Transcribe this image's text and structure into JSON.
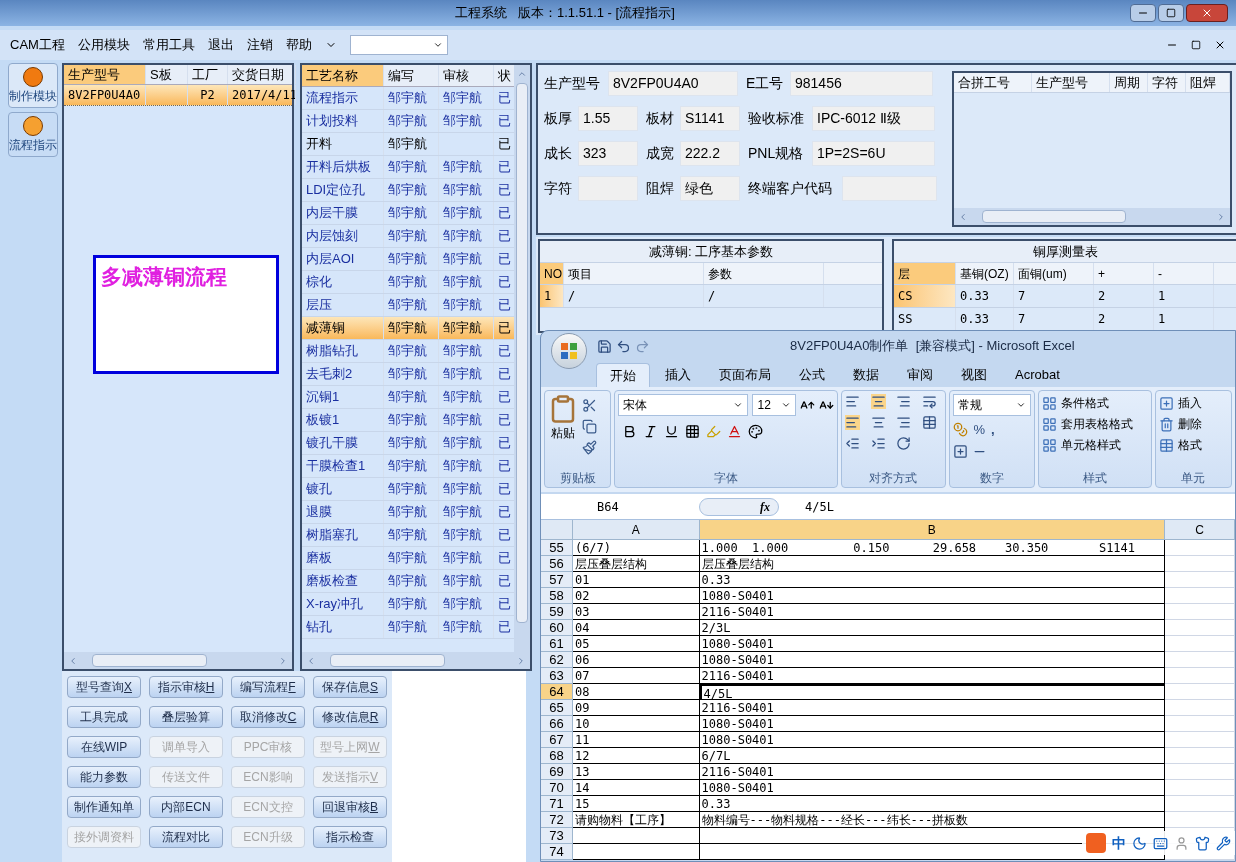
{
  "window": {
    "title": "工程系统   版本：1.1.51.1 - [流程指示]"
  },
  "menu": [
    "CAM工程",
    "公用模块",
    "常用工具",
    "退出",
    "注销",
    "帮助"
  ],
  "sidebar": [
    {
      "label": "制作模块",
      "selected": false
    },
    {
      "label": "流程指示",
      "selected": true
    }
  ],
  "orders": {
    "columns": [
      "生产型号",
      "S板",
      "工厂",
      "交货日期"
    ],
    "rows": [
      {
        "cells": [
          "8V2FP0U4A0",
          "",
          "P2",
          "2017/4/11"
        ],
        "selected": true
      }
    ],
    "note": "多减薄铜流程"
  },
  "process": {
    "columns": [
      "工艺名称",
      "编写",
      "审核",
      "状"
    ],
    "rows": [
      {
        "name": "流程指示",
        "writer": "邹宇航",
        "reviewer": "邹宇航",
        "status": "已",
        "approved": true,
        "selected": false
      },
      {
        "name": "计划投料",
        "writer": "邹宇航",
        "reviewer": "邹宇航",
        "status": "已",
        "approved": true,
        "selected": false
      },
      {
        "name": "开料",
        "writer": "邹宇航",
        "reviewer": "",
        "status": "已",
        "approved": false,
        "selected": false
      },
      {
        "name": "开料后烘板",
        "writer": "邹宇航",
        "reviewer": "邹宇航",
        "status": "已",
        "approved": true,
        "selected": false
      },
      {
        "name": "LDI定位孔",
        "writer": "邹宇航",
        "reviewer": "邹宇航",
        "status": "已",
        "approved": true,
        "selected": false
      },
      {
        "name": "内层干膜",
        "writer": "邹宇航",
        "reviewer": "邹宇航",
        "status": "已",
        "approved": true,
        "selected": false
      },
      {
        "name": "内层蚀刻",
        "writer": "邹宇航",
        "reviewer": "邹宇航",
        "status": "已",
        "approved": true,
        "selected": false
      },
      {
        "name": "内层AOI",
        "writer": "邹宇航",
        "reviewer": "邹宇航",
        "status": "已",
        "approved": true,
        "selected": false
      },
      {
        "name": "棕化",
        "writer": "邹宇航",
        "reviewer": "邹宇航",
        "status": "已",
        "approved": true,
        "selected": false
      },
      {
        "name": "层压",
        "writer": "邹宇航",
        "reviewer": "邹宇航",
        "status": "已",
        "approved": true,
        "selected": false
      },
      {
        "name": "减薄铜",
        "writer": "邹宇航",
        "reviewer": "邹宇航",
        "status": "已",
        "approved": true,
        "selected": true
      },
      {
        "name": "树脂钻孔",
        "writer": "邹宇航",
        "reviewer": "邹宇航",
        "status": "已",
        "approved": true,
        "selected": false
      },
      {
        "name": "去毛刺2",
        "writer": "邹宇航",
        "reviewer": "邹宇航",
        "status": "已",
        "approved": true,
        "selected": false
      },
      {
        "name": "沉铜1",
        "writer": "邹宇航",
        "reviewer": "邹宇航",
        "status": "已",
        "approved": true,
        "selected": false
      },
      {
        "name": "板镀1",
        "writer": "邹宇航",
        "reviewer": "邹宇航",
        "status": "已",
        "approved": true,
        "selected": false
      },
      {
        "name": "镀孔干膜",
        "writer": "邹宇航",
        "reviewer": "邹宇航",
        "status": "已",
        "approved": true,
        "selected": false
      },
      {
        "name": "干膜检查1",
        "writer": "邹宇航",
        "reviewer": "邹宇航",
        "status": "已",
        "approved": true,
        "selected": false
      },
      {
        "name": "镀孔",
        "writer": "邹宇航",
        "reviewer": "邹宇航",
        "status": "已",
        "approved": true,
        "selected": false
      },
      {
        "name": "退膜",
        "writer": "邹宇航",
        "reviewer": "邹宇航",
        "status": "已",
        "approved": true,
        "selected": false
      },
      {
        "name": "树脂塞孔",
        "writer": "邹宇航",
        "reviewer": "邹宇航",
        "status": "已",
        "approved": true,
        "selected": false
      },
      {
        "name": "磨板",
        "writer": "邹宇航",
        "reviewer": "邹宇航",
        "status": "已",
        "approved": true,
        "selected": false
      },
      {
        "name": "磨板检查",
        "writer": "邹宇航",
        "reviewer": "邹宇航",
        "status": "已",
        "approved": true,
        "selected": false
      },
      {
        "name": "X-ray冲孔",
        "writer": "邹宇航",
        "reviewer": "邹宇航",
        "status": "已",
        "approved": true,
        "selected": false
      },
      {
        "name": "钻孔",
        "writer": "邹宇航",
        "reviewer": "邹宇航",
        "status": "已",
        "approved": true,
        "selected": false
      }
    ]
  },
  "info": {
    "fields": [
      {
        "label": "生产型号",
        "value": "8V2FP0U4A0"
      },
      {
        "label": "E工号",
        "value": "981456"
      },
      {
        "label": "板厚",
        "value": "1.55"
      },
      {
        "label": "板材",
        "value": "S1141"
      },
      {
        "label": "验收标准",
        "value": "IPC-6012 Ⅱ级"
      },
      {
        "label": "成长",
        "value": "323"
      },
      {
        "label": "成宽",
        "value": "222.2"
      },
      {
        "label": "PNL规格",
        "value": "1P=2S=6U"
      },
      {
        "label": "字符"
      },
      {
        "label": "阻焊",
        "value": "绿色"
      },
      {
        "label": "终端客户代码"
      }
    ],
    "merge_columns": [
      "合拼工号",
      "生产型号",
      "周期",
      "字符",
      "阻焊"
    ]
  },
  "params": {
    "title": "减薄铜: 工序基本参数",
    "columns": [
      "NO",
      "项目",
      "参数"
    ],
    "rows": [
      {
        "cells": [
          "1",
          "/",
          "/"
        ],
        "selected": true
      }
    ]
  },
  "copper": {
    "title": "铜厚测量表",
    "columns": [
      "层",
      "基铜(OZ)",
      "面铜(um)",
      "+",
      "-"
    ],
    "rows": [
      {
        "cells": [
          "CS",
          "0.33",
          "7",
          "2",
          "1"
        ],
        "selected": true
      },
      {
        "cells": [
          "SS",
          "0.33",
          "7",
          "2",
          "1"
        ],
        "selected": false
      }
    ]
  },
  "buttons": [
    {
      "label": "型号查询",
      "hotkey": "X",
      "disabled": false
    },
    {
      "label": "指示审核",
      "hotkey": "H",
      "disabled": false
    },
    {
      "label": "编写流程",
      "hotkey": "F",
      "disabled": false
    },
    {
      "label": "保存信息",
      "hotkey": "S",
      "disabled": false
    },
    {
      "label": "工具完成",
      "disabled": false
    },
    {
      "label": "叠层验算",
      "disabled": false
    },
    {
      "label": "取消修改",
      "hotkey": "C",
      "disabled": false
    },
    {
      "label": "修改信息",
      "hotkey": "R",
      "disabled": false
    },
    {
      "label": "在线WIP",
      "disabled": false
    },
    {
      "label": "调单导入",
      "disabled": true
    },
    {
      "label": "PPC审核",
      "disabled": true
    },
    {
      "label": "型号上网",
      "hotkey": "W",
      "disabled": true
    },
    {
      "label": "能力参数",
      "disabled": false
    },
    {
      "label": "传送文件",
      "disabled": true
    },
    {
      "label": "ECN影响",
      "disabled": true
    },
    {
      "label": "发送指示",
      "hotkey": "V",
      "disabled": true
    },
    {
      "label": "制作通知单",
      "disabled": false
    },
    {
      "label": "内部ECN",
      "disabled": false
    },
    {
      "label": "ECN文控",
      "disabled": true
    },
    {
      "label": "回退审核",
      "hotkey": "B",
      "disabled": false
    },
    {
      "label": "接外调资料",
      "disabled": true
    },
    {
      "label": "流程对比",
      "disabled": false
    },
    {
      "label": "ECN升级",
      "disabled": true
    },
    {
      "label": "指示检查",
      "disabled": false
    }
  ],
  "excel": {
    "title": "8V2FP0U4A0制作单  [兼容模式] - Microsoft Excel",
    "tabs": [
      {
        "label": "开始",
        "selected": true
      },
      {
        "label": "插入",
        "selected": false
      },
      {
        "label": "页面布局",
        "selected": false
      },
      {
        "label": "公式",
        "selected": false
      },
      {
        "label": "数据",
        "selected": false
      },
      {
        "label": "审阅",
        "selected": false
      },
      {
        "label": "视图",
        "selected": false
      },
      {
        "label": "Acrobat",
        "selected": false
      }
    ],
    "ribbon": {
      "paste": "粘贴",
      "font": "宋体",
      "size": "12",
      "number_format": "常规",
      "percent": "%",
      "comma": ",",
      "styles": [
        "条件格式",
        "套用表格格式",
        "单元格样式"
      ],
      "cells": [
        "插入",
        "删除",
        "格式"
      ],
      "groups": [
        "剪贴板",
        "字体",
        "对齐方式",
        "数字",
        "样式",
        "单元"
      ]
    },
    "name_box": "B64",
    "fx_label": "fx",
    "formula": "4/5L",
    "columns": [
      {
        "label": "A",
        "selected": false
      },
      {
        "label": "B",
        "selected": true
      },
      {
        "label": "C",
        "selected": false
      }
    ],
    "rows": [
      {
        "num": "55",
        "a": "(6/7)",
        "b": "1.000  1.000         0.150      29.658    30.350       S1141",
        "selected": false
      },
      {
        "num": "56",
        "a": "层压叠层结构",
        "b": "层压叠层结构",
        "selected": false
      },
      {
        "num": "57",
        "a": "01",
        "b": "0.33",
        "selected": false
      },
      {
        "num": "58",
        "a": "02",
        "b": "1080-S0401",
        "selected": false
      },
      {
        "num": "59",
        "a": "03",
        "b": "2116-S0401",
        "selected": false
      },
      {
        "num": "60",
        "a": "04",
        "b": "2/3L",
        "selected": false
      },
      {
        "num": "61",
        "a": "05",
        "b": "1080-S0401",
        "selected": false
      },
      {
        "num": "62",
        "a": "06",
        "b": "1080-S0401",
        "selected": false
      },
      {
        "num": "63",
        "a": "07",
        "b": "2116-S0401",
        "selected": false
      },
      {
        "num": "64",
        "a": "08",
        "b": "4/5L",
        "selected": true
      },
      {
        "num": "65",
        "a": "09",
        "b": "2116-S0401",
        "selected": false
      },
      {
        "num": "66",
        "a": "10",
        "b": "1080-S0401",
        "selected": false
      },
      {
        "num": "67",
        "a": "11",
        "b": "1080-S0401",
        "selected": false
      },
      {
        "num": "68",
        "a": "12",
        "b": "6/7L",
        "selected": false
      },
      {
        "num": "69",
        "a": "13",
        "b": "2116-S0401",
        "selected": false
      },
      {
        "num": "70",
        "a": "14",
        "b": "1080-S0401",
        "selected": false
      },
      {
        "num": "71",
        "a": "15",
        "b": "0.33",
        "selected": false
      },
      {
        "num": "72",
        "a": "请购物料【工序】",
        "b": "物料编号---物料规格---经长---纬长---拼板数",
        "selected": false
      },
      {
        "num": "73",
        "a": "",
        "b": "",
        "selected": false
      },
      {
        "num": "74",
        "a": "",
        "b": "",
        "selected": false
      }
    ]
  },
  "ime": {
    "label": "中"
  }
}
